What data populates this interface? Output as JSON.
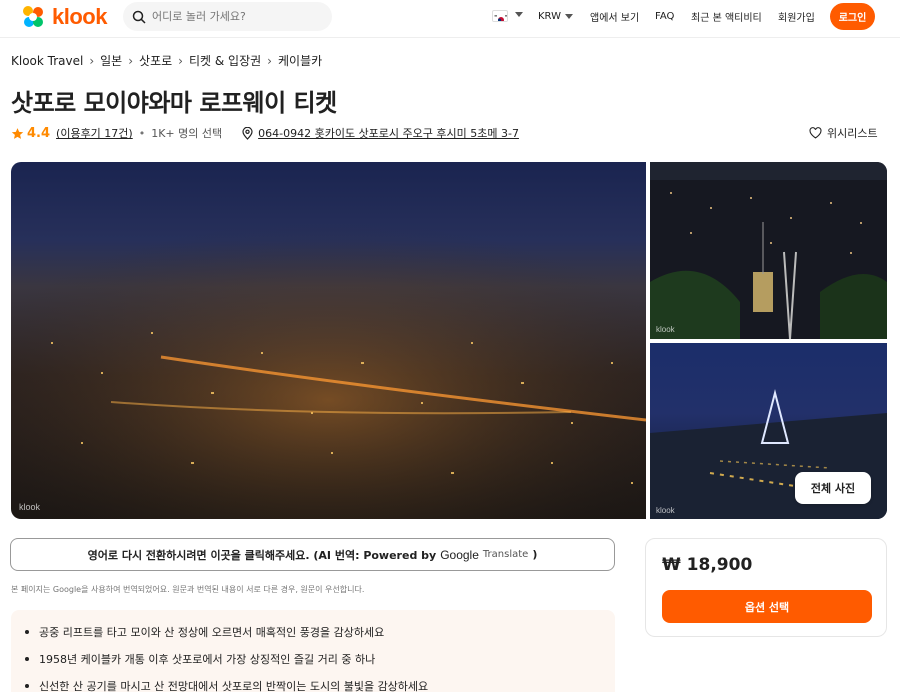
{
  "header": {
    "brand": "klook",
    "search_placeholder": "어디로 놀러 가세요?",
    "currency": "KRW",
    "app_link": "앱에서 보기",
    "faq": "FAQ",
    "recent": "최근 본 액티비티",
    "signup": "회원가입",
    "login": "로그인"
  },
  "breadcrumb": [
    "Klook Travel",
    "일본",
    "삿포로",
    "티켓 & 입장권",
    "케이블카"
  ],
  "title": "삿포로 모이야와마 로프웨이 티켓",
  "meta": {
    "rating": "4.4",
    "reviews": "(이용후기 17건)",
    "choice": "1K+ 명의 선택",
    "address": "064-0942 홋카이도 삿포로시 주오구 후시미 5초메 3-7",
    "wishlist": "위시리스트"
  },
  "gallery": {
    "watermark": "klook",
    "all_photos": "전체 사진"
  },
  "translate": {
    "text": "영어로 다시 전환하시려면 이곳을 클릭해주세요. (AI 번역: Powered by",
    "google": "Google",
    "translate_word": "Translate",
    "close_paren": ")",
    "note": "본 페이지는 Google을 사용하여 번역되었어요. 원문과 번역된 내용이 서로 다른 경우, 원문이 우선합니다."
  },
  "highlights": [
    "공중 리프트를 타고 모이와 산 정상에 오르면서 매혹적인 풍경을 감상하세요",
    "1958년 케이블카 개통 이후 삿포로에서 가장 상징적인 즐길 거리 중 하나",
    "신선한 산 공기를 마시고 산 전망대에서 삿포로의 반짝이는 도시의 불빛을 감상하세요"
  ],
  "price_card": {
    "price": "₩ 18,900",
    "select_button": "옵션 선택"
  },
  "colors": {
    "accent": "#ff5b00",
    "star": "#ff8a00"
  }
}
